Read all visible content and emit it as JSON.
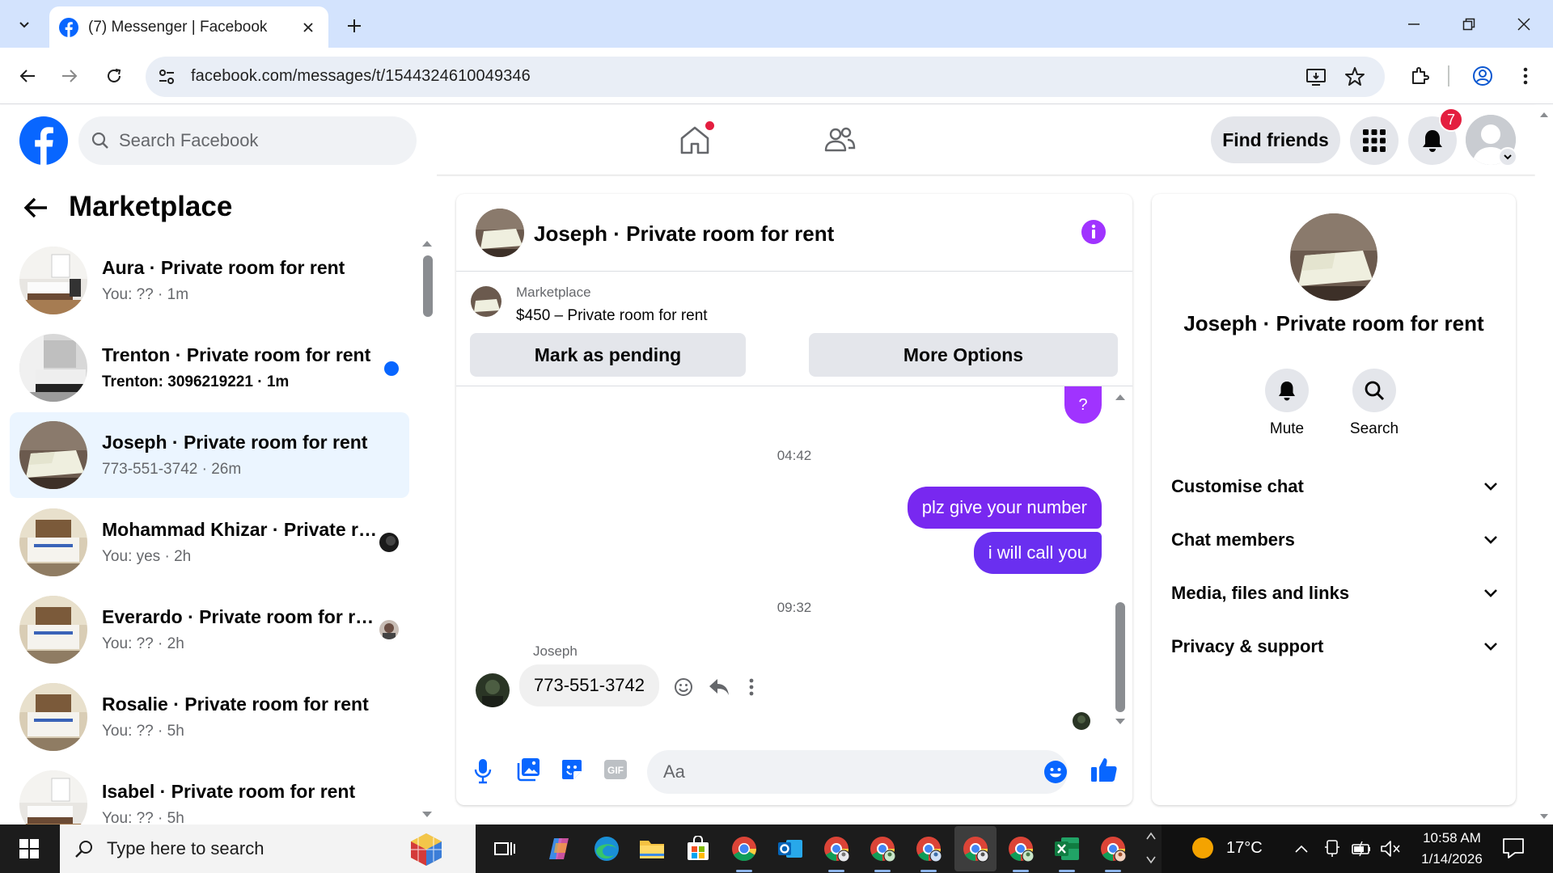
{
  "browser": {
    "tab_title": "(7) Messenger | Facebook",
    "url": "facebook.com/messages/t/1544324610049346"
  },
  "fb": {
    "search_placeholder": "Search Facebook",
    "find_friends": "Find friends",
    "notif_count": "7",
    "brand_color": "#0866ff"
  },
  "sidebar": {
    "title": "Marketplace",
    "conversations": [
      {
        "name": "Aura · Private room for rent",
        "sub": "You: ?? · 1m"
      },
      {
        "name": "Trenton · Private room for rent",
        "sub": "Trenton: 3096219221 · 1m"
      },
      {
        "name": "Joseph · Private room for rent",
        "sub": "773-551-3742 · 26m"
      },
      {
        "name": "Mohammad Khizar · Private room for rent",
        "sub": "You: yes · 2h"
      },
      {
        "name": "Everardo · Private room for rent",
        "sub": "You: ?? · 2h"
      },
      {
        "name": "Rosalie · Private room for rent",
        "sub": "You: ?? · 5h"
      },
      {
        "name": "Isabel · Private room for rent",
        "sub": "You: ?? · 5h"
      }
    ]
  },
  "chat": {
    "header_name": "Joseph · Private room for rent",
    "listing_label": "Marketplace",
    "listing_title": "$450 – Private room for rent",
    "btn_pending": "Mark as pending",
    "btn_more": "More Options",
    "q_bubble": "?",
    "time1": "04:42",
    "msg1": "plz give your number",
    "msg2": "i will call you",
    "time2": "09:32",
    "sender": "Joseph",
    "msg3": "773-551-3742",
    "input_placeholder": "Aa",
    "accent_color": "#7828f0"
  },
  "details": {
    "name": "Joseph · Private room for rent",
    "mute": "Mute",
    "search": "Search",
    "sections": [
      "Customise chat",
      "Chat members",
      "Media, files and links",
      "Privacy & support"
    ]
  },
  "taskbar": {
    "search_placeholder": "Type here to search",
    "temperature": "17°C",
    "time": "10:58 AM",
    "date": "1/14/2026"
  }
}
